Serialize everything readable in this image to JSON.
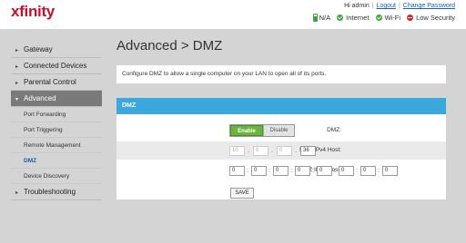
{
  "header": {
    "logo": "xfinity",
    "greeting": "Hi admin",
    "logout": "Logout",
    "change_password": "Change Password",
    "status": {
      "battery": "N/A",
      "internet": "Internet",
      "wifi": "Wi-Fi",
      "security": "Low Security"
    },
    "colors": {
      "brand": "#c8102e",
      "ok": "#3aa63a",
      "warn": "#d6261f"
    }
  },
  "sidebar": {
    "gateway": "Gateway",
    "connected_devices": "Connected Devices",
    "parental_control": "Parental Control",
    "advanced": "Advanced",
    "sub_items": [
      "Port Forwarding",
      "Port Triggering",
      "Remote Management",
      "DMZ",
      "Device Discovery"
    ],
    "troubleshooting": "Troubleshooting"
  },
  "main": {
    "title": "Advanced > DMZ",
    "description": "Configure DMZ to allow a single computer on your LAN to open all of its ports.",
    "panel_title": "DMZ",
    "dmz_label": "DMZ:",
    "enable": "Enable",
    "disable": "Disable",
    "ipv4_label": "DMZ IPv4 Host:",
    "ipv4": [
      "10",
      "0",
      "0",
      "36"
    ],
    "ipv6_label": "DMZ IPv6 Host:",
    "ipv6": [
      "0",
      "0",
      "0",
      "0",
      "0",
      "0",
      "0",
      "0"
    ],
    "save": "SAVE",
    "accent_color": "#3aa7dd"
  }
}
